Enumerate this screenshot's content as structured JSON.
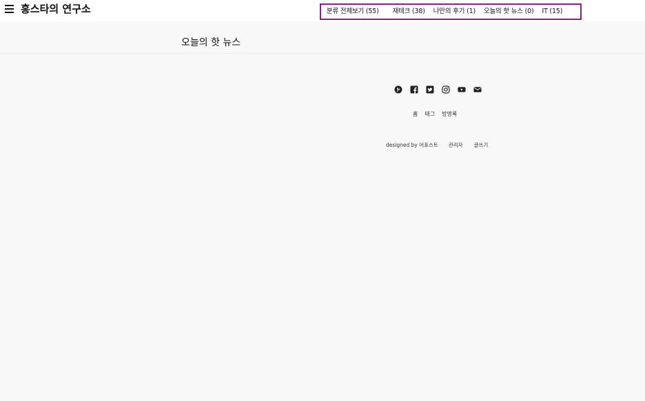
{
  "header": {
    "blog_title": "홍스타의 연구소",
    "menu_icon": "hamburger-menu-icon"
  },
  "category_nav": {
    "items": [
      "분류 전체보기 (55)",
      "재테크 (38)",
      "나만의 후기 (1)",
      "오늘의 핫 뉴스 (0)",
      "IT (15)"
    ],
    "highlight_color": "#8b1a8b"
  },
  "main": {
    "heading": "오늘의 핫 뉴스"
  },
  "footer": {
    "social_icons": [
      "pinterest-icon",
      "facebook-icon",
      "twitter-icon",
      "instagram-icon",
      "youtube-icon",
      "mail-icon"
    ],
    "links": [
      "홈",
      "태그",
      "방명록"
    ],
    "credit": "designed by 어포스트",
    "admin": "관리자",
    "write": "글쓰기"
  }
}
